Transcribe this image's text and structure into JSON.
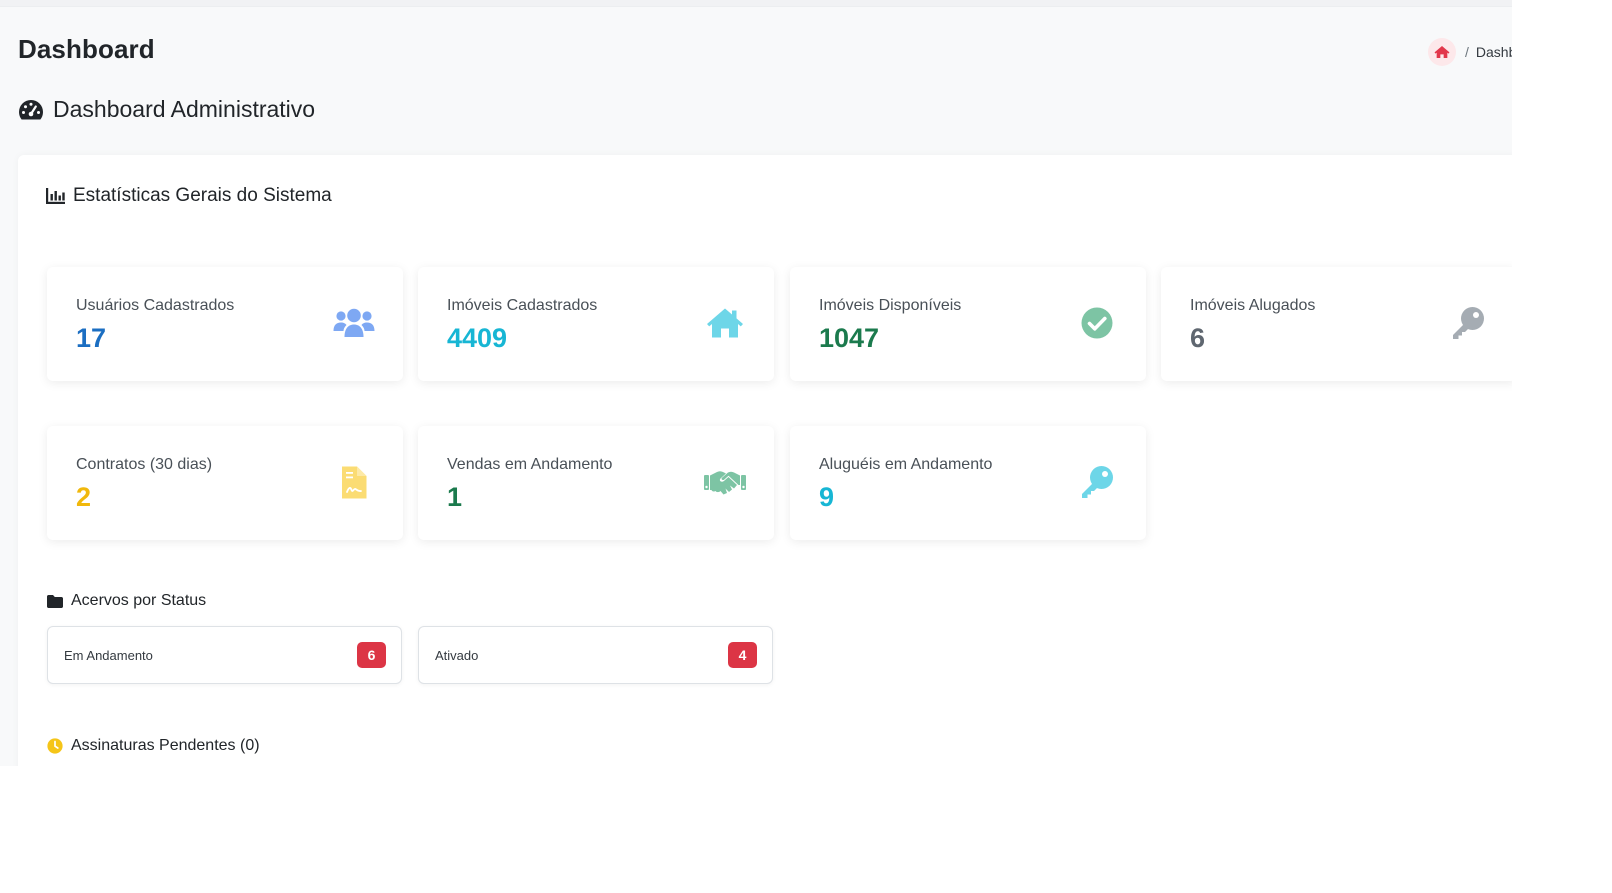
{
  "header": {
    "title": "Dashboard",
    "breadcrumb": {
      "home_icon": "home-icon",
      "separator": "/",
      "current": "Dashb"
    }
  },
  "section": {
    "title": "Dashboard Administrativo",
    "icon": "tachometer-icon"
  },
  "stats_panel": {
    "title": "Estatísticas Gerais do Sistema",
    "icon": "bar-chart-icon",
    "cards": [
      {
        "label": "Usuários Cadastrados",
        "value": "17",
        "icon": "users-icon",
        "value_color": "#1b6ec2",
        "icon_color": "#7ea8f3"
      },
      {
        "label": "Imóveis Cadastrados",
        "value": "4409",
        "icon": "home-icon",
        "value_color": "#17b6d4",
        "icon_color": "#6dd6e8"
      },
      {
        "label": "Imóveis Disponíveis",
        "value": "1047",
        "icon": "check-circle-icon",
        "value_color": "#1b7a4d",
        "icon_color": "#7dc4a4"
      },
      {
        "label": "Imóveis Alugados",
        "value": "6",
        "icon": "key-icon",
        "value_color": "#5f6770",
        "icon_color": "#a5acb3"
      },
      {
        "label": "Contratos (30 dias)",
        "value": "2",
        "icon": "file-contract-icon",
        "value_color": "#f1b80c",
        "icon_color": "#fbdc73"
      },
      {
        "label": "Vendas em Andamento",
        "value": "1",
        "icon": "handshake-icon",
        "value_color": "#1b7a4d",
        "icon_color": "#7dc4a4"
      },
      {
        "label": "Aluguéis em Andamento",
        "value": "9",
        "icon": "key-icon",
        "value_color": "#17b6d4",
        "icon_color": "#6dd6e8"
      }
    ]
  },
  "acervos": {
    "title": "Acervos por Status",
    "icon": "folder-icon",
    "items": [
      {
        "label": "Em Andamento",
        "count": "6",
        "badge_color": "#dc3545"
      },
      {
        "label": "Ativado",
        "count": "4",
        "badge_color": "#dc3545"
      }
    ]
  },
  "assinaturas": {
    "title": "Assinaturas Pendentes (0)",
    "icon": "clock-icon",
    "icon_color": "#f5c518"
  }
}
